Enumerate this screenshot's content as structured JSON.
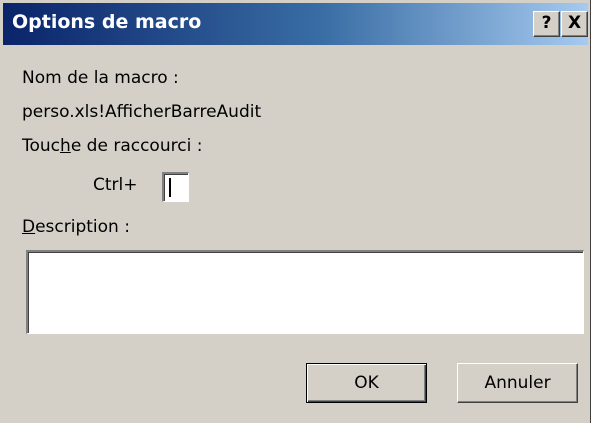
{
  "window": {
    "title": "Options de macro",
    "help_label": "?",
    "close_label": "X"
  },
  "macro_name": {
    "label": "Nom de la macro :",
    "value": "perso.xls!AfficherBarreAudit"
  },
  "shortcut": {
    "label_before_mnemonic": "Touc",
    "label_mnemonic": "h",
    "label_after_mnemonic": "e de raccourci :",
    "ctrl_label": "Ctrl+",
    "value": ""
  },
  "description": {
    "label_mnemonic": "D",
    "label_rest": "escription :",
    "value": ""
  },
  "buttons": {
    "ok_label": "OK",
    "cancel_label": "Annuler"
  },
  "colors": {
    "face": "#d4d0c8",
    "title_start": "#0a246a",
    "title_end": "#a6caf0",
    "title_text": "#ffffff"
  }
}
